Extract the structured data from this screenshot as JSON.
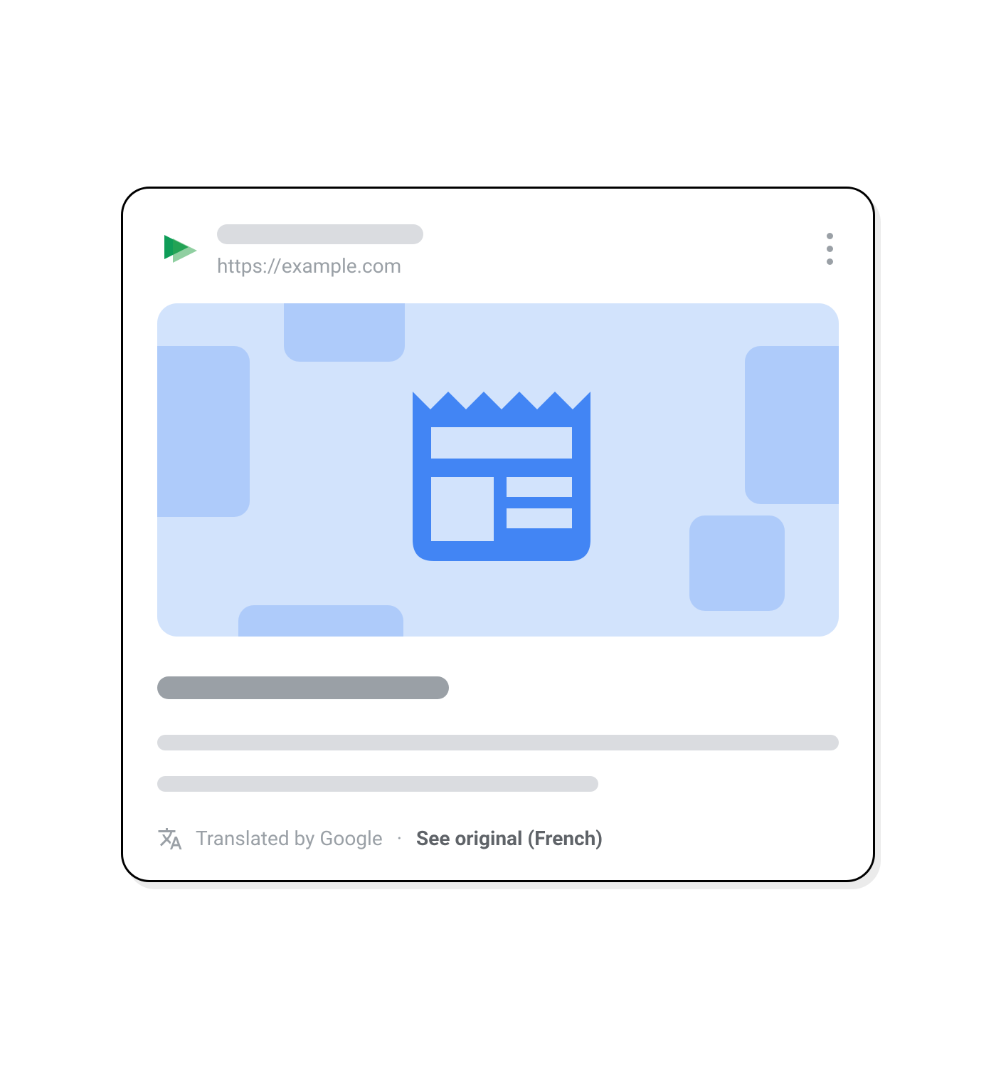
{
  "header": {
    "url": "https://example.com"
  },
  "footer": {
    "translated_label": "Translated by Google",
    "separator": "·",
    "see_original_label": "See original (French)"
  }
}
